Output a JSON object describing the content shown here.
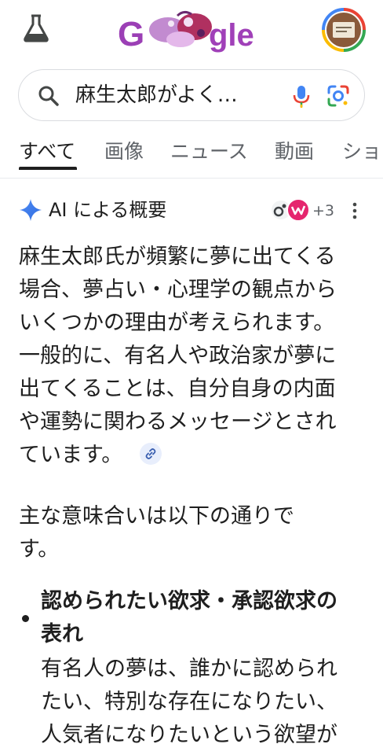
{
  "header": {
    "labs_icon": "flask-icon",
    "logo_text": "Google",
    "avatar_icon": "profile-avatar-icon"
  },
  "search": {
    "query": "麻生太郎がよく…",
    "search_icon": "search-icon",
    "voice_icon": "microphone-icon",
    "lens_icon": "google-lens-icon"
  },
  "tabs": [
    {
      "label": "すべて",
      "active": true
    },
    {
      "label": "画像",
      "active": false
    },
    {
      "label": "ニュース",
      "active": false
    },
    {
      "label": "動画",
      "active": false
    },
    {
      "label": "ショ",
      "active": false
    }
  ],
  "ai_overview": {
    "title": "AI による概要",
    "sparkle_icon": "gemini-sparkle-icon",
    "sources_count": "+3",
    "more_icon": "more-vertical-icon",
    "paragraph1_lines": [
      "麻生太郎氏が頻繁に夢に出てくる",
      "場合、夢占い・心理学の観点から",
      "いくつかの理由が考えられます。",
      "一般的に、有名人や政治家が夢に",
      "出てくることは、自分自身の内面",
      "や運勢に関わるメッセージとされ",
      "ています。"
    ],
    "link_icon": "link-icon",
    "paragraph2_lines": [
      "主な意味合いは以下の通りで",
      "す。"
    ],
    "bullet1": {
      "heading_lines": [
        "認められたい欲求・承認欲求の",
        "表れ"
      ],
      "body_lines": [
        "有名人の夢は、誰かに認められ",
        "たい、特別な存在になりたい、",
        "人気者になりたいという欲望が"
      ]
    }
  }
}
